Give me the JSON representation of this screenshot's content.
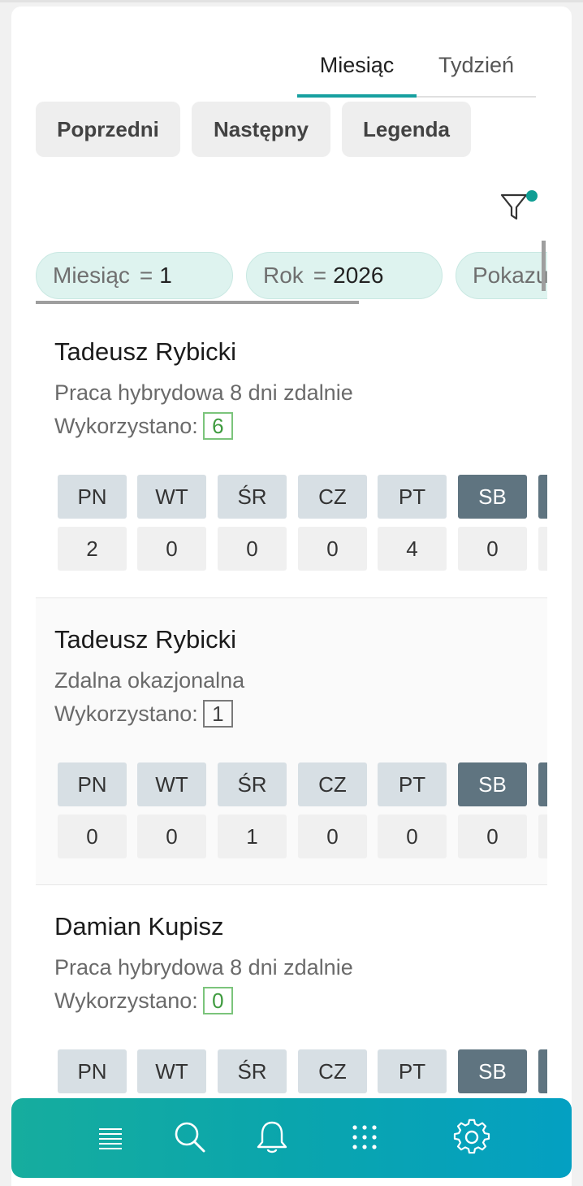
{
  "tabs": [
    {
      "label": "Miesiąc",
      "active": true
    },
    {
      "label": "Tydzień",
      "active": false
    }
  ],
  "buttons": {
    "prev": "Poprzedni",
    "next": "Następny",
    "legend": "Legenda"
  },
  "filter": {
    "icon": "filter-icon",
    "indicator_color": "#0f9e94"
  },
  "chips": [
    {
      "key": "Miesiąc",
      "op": "=",
      "value": "1"
    },
    {
      "key": "Rok",
      "op": "=",
      "value": "2026"
    },
    {
      "key": "Pokazu",
      "op": "",
      "value": ""
    }
  ],
  "day_headers": [
    "PN",
    "WT",
    "ŚR",
    "CZ",
    "PT",
    "SB"
  ],
  "employees": [
    {
      "name": "Tadeusz Rybicki",
      "type": "Praca hybrydowa 8 dni zdalnie",
      "used_label": "Wykorzystano:",
      "used": "6",
      "badge_style": "green",
      "counts": [
        "2",
        "0",
        "0",
        "0",
        "4",
        "0"
      ]
    },
    {
      "name": "Tadeusz Rybicki",
      "type": "Zdalna okazjonalna",
      "used_label": "Wykorzystano:",
      "used": "1",
      "badge_style": "gray",
      "counts": [
        "0",
        "0",
        "1",
        "0",
        "0",
        "0"
      ]
    },
    {
      "name": "Damian Kupisz",
      "type": "Praca hybrydowa 8 dni zdalnie",
      "used_label": "Wykorzystano:",
      "used": "0",
      "badge_style": "green",
      "counts": []
    }
  ],
  "bottom_nav": [
    "menu-icon",
    "search-icon",
    "bell-icon",
    "apps-grid-icon",
    "settings-icon"
  ],
  "colors": {
    "accent": "#16a0a0",
    "weekend": "#5f7480",
    "chip": "#def3ef"
  }
}
